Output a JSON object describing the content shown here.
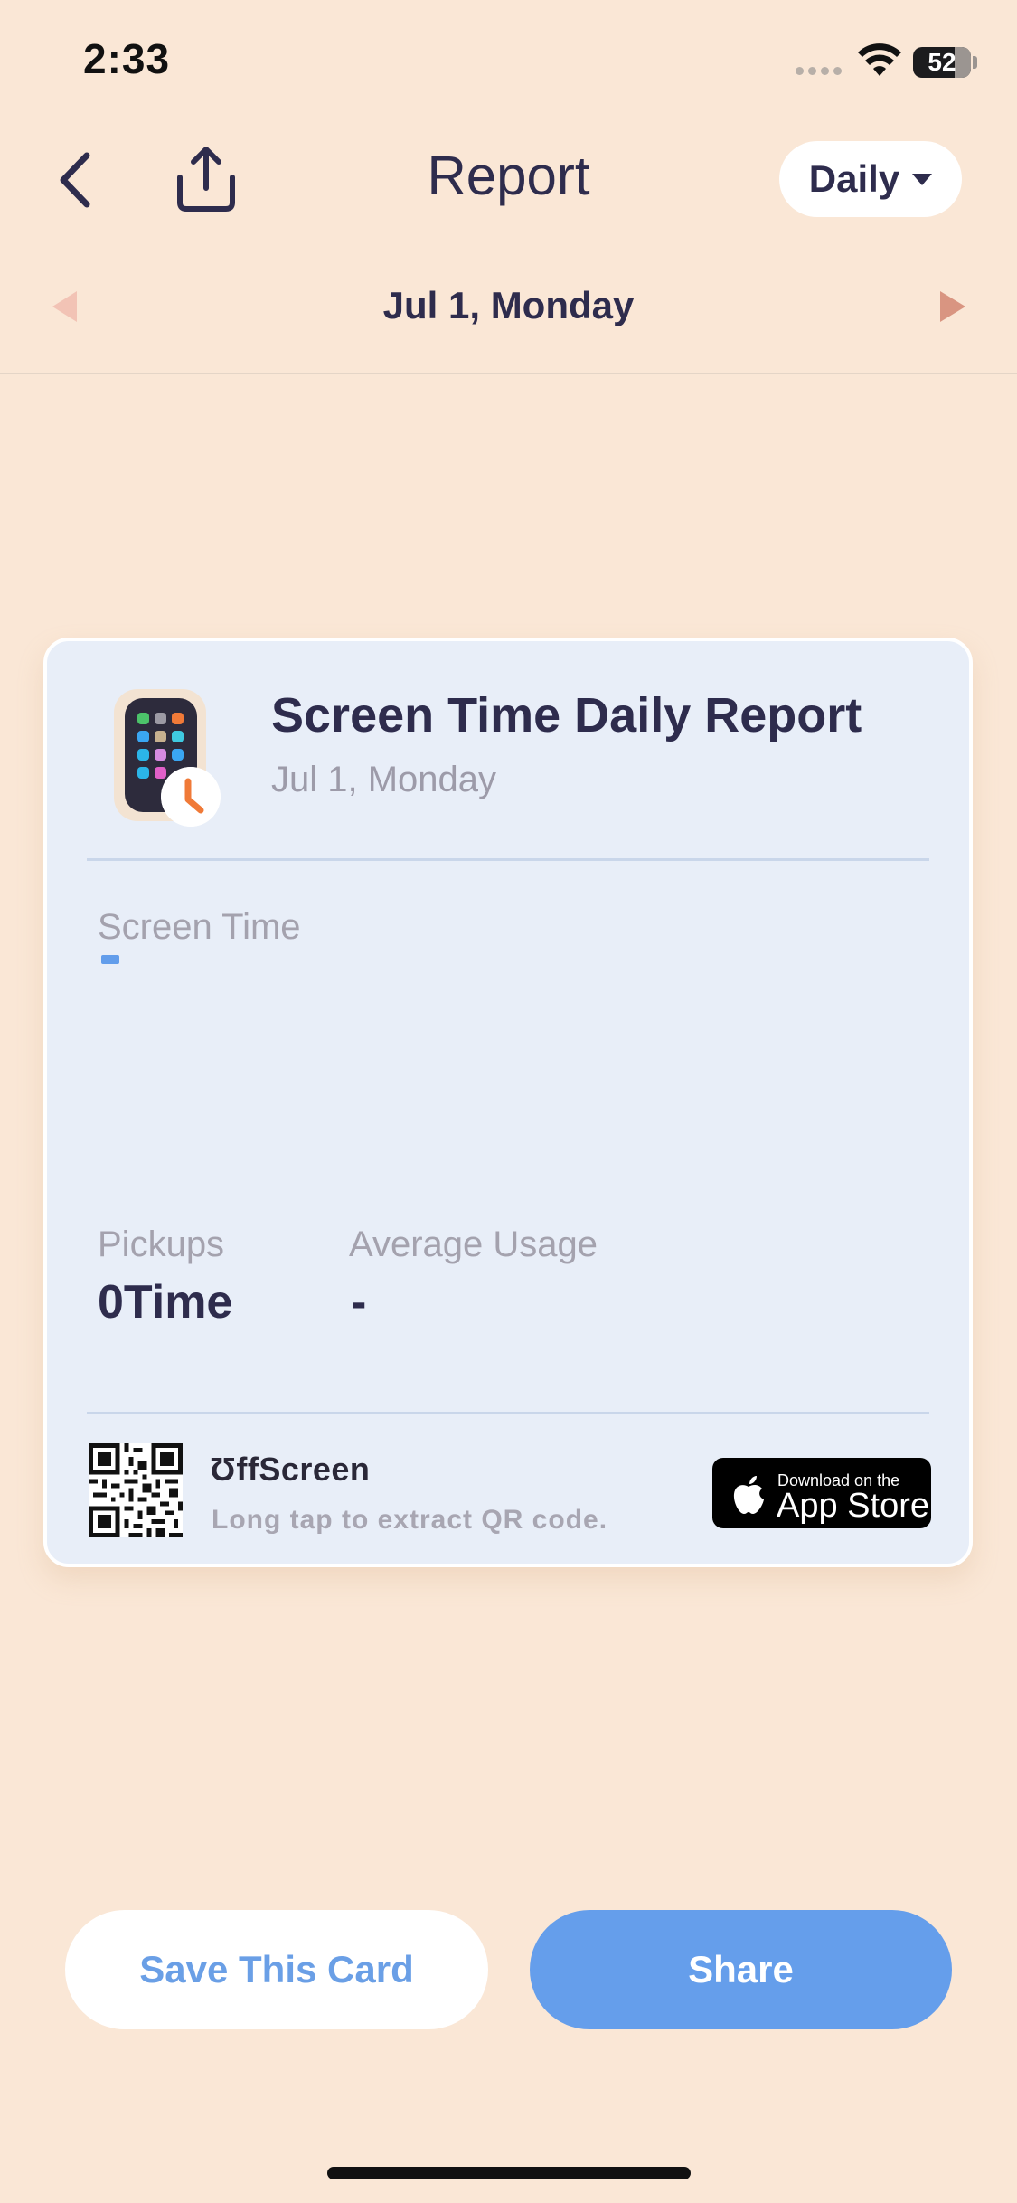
{
  "status_bar": {
    "time": "2:33",
    "battery_percent": "52",
    "wifi_icon": "wifi-icon",
    "signal_icon": "cellular-signal-icon"
  },
  "nav": {
    "title": "Report",
    "back_icon": "chevron-left-icon",
    "share_icon": "upload-share-icon",
    "period_label": "Daily",
    "period_icon": "caret-down-icon"
  },
  "date_nav": {
    "label": "Jul 1, Monday",
    "prev_icon": "triangle-left-icon",
    "next_icon": "triangle-right-icon"
  },
  "card": {
    "title": "Screen Time Daily Report",
    "subtitle": "Jul 1, Monday",
    "app_icon": "phone-clock-app-icon",
    "screen_time_label": "Screen Time",
    "pickups_label": "Pickups",
    "pickups_value": "0Time",
    "average_usage_label": "Average Usage",
    "average_usage_value": "-",
    "brand": "ƱffScreen",
    "qr_hint": "Long tap to extract QR code.",
    "qr_icon": "qr-code-icon",
    "appstore_small": "Download on the",
    "appstore_big": "App Store",
    "apple_icon": "apple-logo-icon"
  },
  "actions": {
    "save_label": "Save This Card",
    "share_label": "Share"
  },
  "colors": {
    "background": "#FAE7D6",
    "card": "#E8EEF8",
    "accent_blue": "#659EEB",
    "text_dark": "#2E2C4D"
  }
}
